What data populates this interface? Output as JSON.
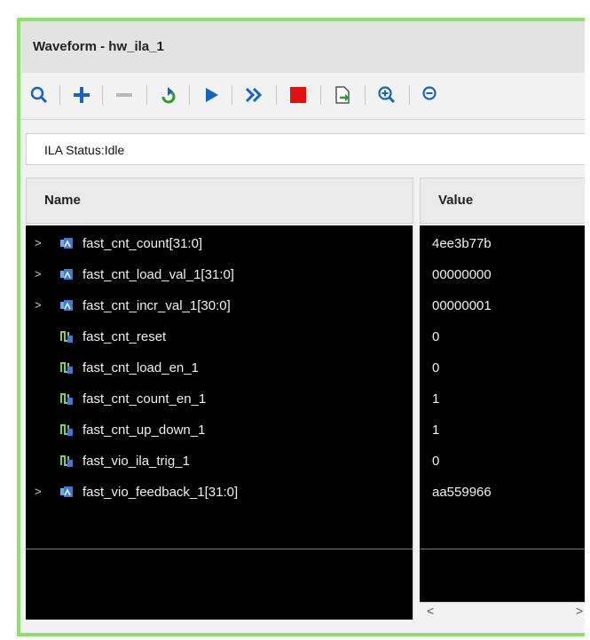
{
  "window": {
    "title": "Waveform - hw_ila_1"
  },
  "toolbar": {
    "buttons": [
      {
        "name": "search",
        "icon": "search-icon"
      },
      {
        "name": "add",
        "icon": "plus-icon"
      },
      {
        "name": "remove",
        "icon": "minus-icon"
      },
      {
        "name": "refresh",
        "icon": "refresh-icon"
      },
      {
        "name": "run-trigger",
        "icon": "play-icon"
      },
      {
        "name": "run-immediate",
        "icon": "fast-forward-icon"
      },
      {
        "name": "stop",
        "icon": "stop-icon"
      },
      {
        "name": "export",
        "icon": "export-icon"
      },
      {
        "name": "zoom-in",
        "icon": "zoom-in-icon"
      },
      {
        "name": "zoom-out",
        "icon": "zoom-out-icon"
      }
    ],
    "colors": {
      "blue": "#1565c0",
      "green": "#2e9d2e",
      "red": "#e01010",
      "grey": "#b9b9b9"
    }
  },
  "status": {
    "text": "ILA Status:Idle"
  },
  "table": {
    "columns": {
      "name": "Name",
      "value": "Value"
    },
    "rows": [
      {
        "name": "fast_cnt_count[31:0]",
        "value": "4ee3b77b",
        "bus": true
      },
      {
        "name": "fast_cnt_load_val_1[31:0]",
        "value": "00000000",
        "bus": true
      },
      {
        "name": "fast_cnt_incr_val_1[30:0]",
        "value": "00000001",
        "bus": true
      },
      {
        "name": "fast_cnt_reset",
        "value": "0",
        "bus": false
      },
      {
        "name": "fast_cnt_load_en_1",
        "value": "0",
        "bus": false
      },
      {
        "name": "fast_cnt_count_en_1",
        "value": "1",
        "bus": false
      },
      {
        "name": "fast_cnt_up_down_1",
        "value": "1",
        "bus": false
      },
      {
        "name": "fast_vio_ila_trig_1",
        "value": "0",
        "bus": false
      },
      {
        "name": "fast_vio_feedback_1[31:0]",
        "value": "aa559966",
        "bus": true
      }
    ]
  },
  "scrollbar": {
    "left_arrow": "<",
    "right_arrow": ">"
  }
}
